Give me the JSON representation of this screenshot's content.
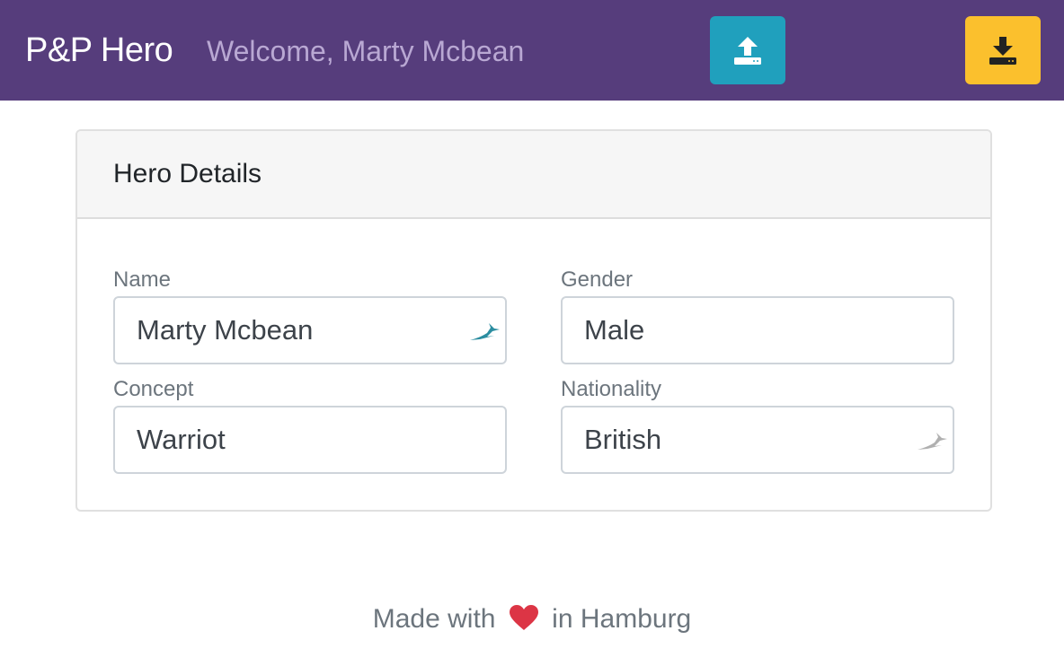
{
  "navbar": {
    "brand": "P&P Hero",
    "welcome": "Welcome, Marty Mcbean",
    "upload_icon": "upload-icon",
    "download_icon": "download-icon",
    "color": "#563d7c"
  },
  "card": {
    "title": "Hero Details",
    "fields": {
      "name": {
        "label": "Name",
        "value": "Marty Mcbean"
      },
      "gender": {
        "label": "Gender",
        "value": "Male"
      },
      "concept": {
        "label": "Concept",
        "value": "Warriot"
      },
      "nationality": {
        "label": "Nationality",
        "value": "British"
      }
    }
  },
  "footer": {
    "prefix": "Made with",
    "suffix": "in Hamburg",
    "icon": "heart-icon",
    "heart_color": "#dc3545"
  },
  "colors": {
    "upload_button": "#20a0bd",
    "download_button": "#fbc02d"
  }
}
